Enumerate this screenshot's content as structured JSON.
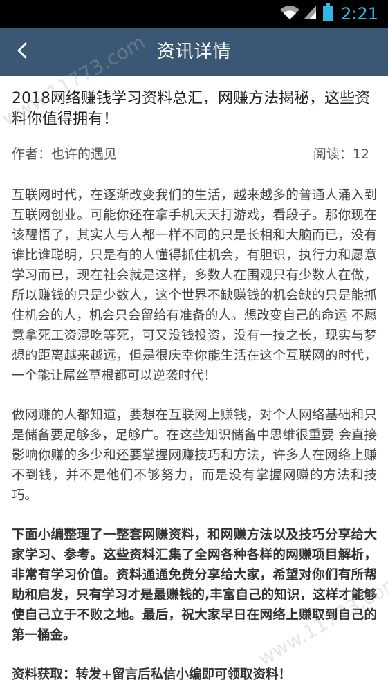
{
  "status_bar": {
    "time": "2:21"
  },
  "header": {
    "title": "资讯详情"
  },
  "article": {
    "title": "2018网络赚钱学习资料总汇，网赚方法揭秘，这些资料你值得拥有！",
    "author": "作者：也许的遇见",
    "reads": "阅读：12",
    "paragraphs": [
      "互联网时代，在逐渐改变我们的生活，越来越多的普通人涌入到互联网创业。可能你还在拿手机天天打游戏，看段子。那你现在该醒悟了，其实人与人都一样不同的只是长相和大脑而已，没有谁比谁聪明，只是有的人懂得抓住机会，有胆识，执行力和愿意学习而已，现在社会就是这样，多数人在围观只有少数人在做，所以赚钱的只是少数人，这个世界不缺赚钱的机会缺的只是能抓住机会的人，机会只会留给有准备的人。想改变自己的命运 不愿意拿死工资混吃等死，可又没钱投资，没有一技之长，现实与梦想的距离越来越远，但是很庆幸你能生活在这个互联网的时代，一个能让屌丝草根都可以逆袭时代！",
      "做网赚的人都知道，要想在互联网上赚钱，对个人网络基础和只是储备要足够多，足够广。在这些知识储备中思维很重要 会直接影响你赚的多少和还要掌握网赚技巧和方法，许多人在网络上赚不到钱，并不是他们不够努力，而是没有掌握网赚的方法和技巧。",
      "下面小编整理了一整套网赚资料，和网赚方法以及技巧分享给大家学习、参考。这些资料汇集了全网各种各样的网赚项目解析，非常有学习价值。资料通通免费分享给大家，希望对你们有所帮助和启发，只有学习才是最赚钱的,丰富自己的知识，这样才能够使自己立于不败之地。最后，祝大家早日在网络上赚取到自己的第一桶金。",
      "资料获取：转发+留言后私信小编即可领取资料！"
    ]
  },
  "watermark": {
    "text": "www.11773.com"
  },
  "colors": {
    "navbar": "#3a5874",
    "status_accent": "#33b5e5"
  },
  "icons": [
    "wifi-icon",
    "signal-icon",
    "battery-icon",
    "back-arrow-icon"
  ]
}
